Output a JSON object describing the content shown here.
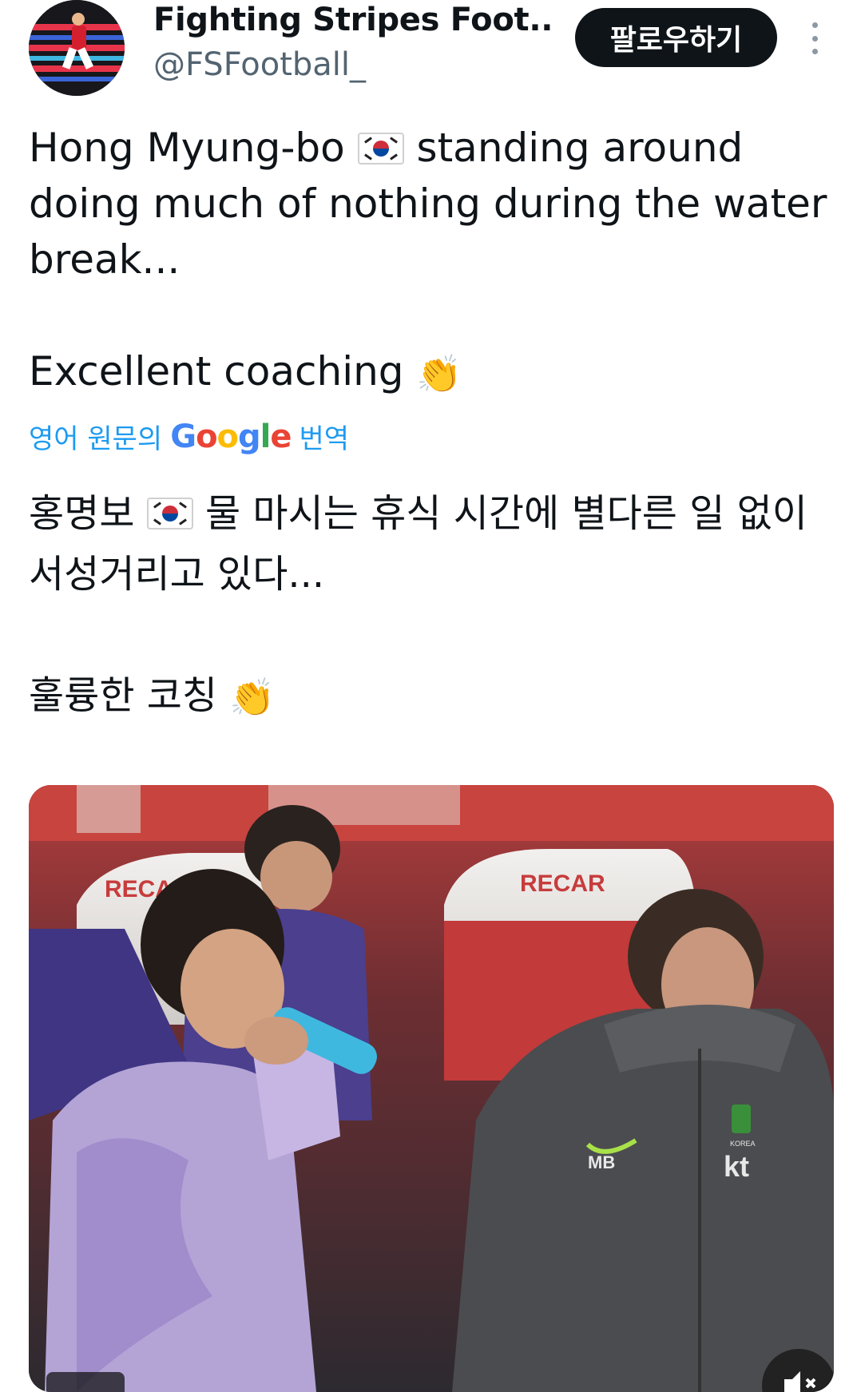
{
  "author": {
    "display_name": "Fighting Stripes Foot...",
    "handle": "@FSFootball_"
  },
  "follow_button": {
    "label": "팔로우하기"
  },
  "tweet": {
    "lines": [
      [
        "Hong Myung-bo ",
        " standing around"
      ],
      "doing much of nothing during the water",
      "break...",
      "Excellent coaching "
    ]
  },
  "translate": {
    "prefix": "영어 원문의",
    "brand": "Google",
    "suffix": "번역"
  },
  "translation": {
    "line1a": "홍명보 ",
    "line1b": " 물 마시는 휴식 시간에 별다른 일 없이",
    "line2": "서성거리고 있다...",
    "line3": "훌륭한 코칭 "
  },
  "media": {
    "bench_brand_left": "RECARO",
    "bench_brand_right": "RECAR",
    "jacket_initials": "MB",
    "jacket_sponsor": "kt",
    "jacket_badge_text": "KOREA"
  },
  "icons": {
    "more": "more-vertical-icon",
    "flag": "south-korea-flag",
    "clap": "clapping-hands-emoji",
    "mute": "muted-speaker-icon"
  }
}
